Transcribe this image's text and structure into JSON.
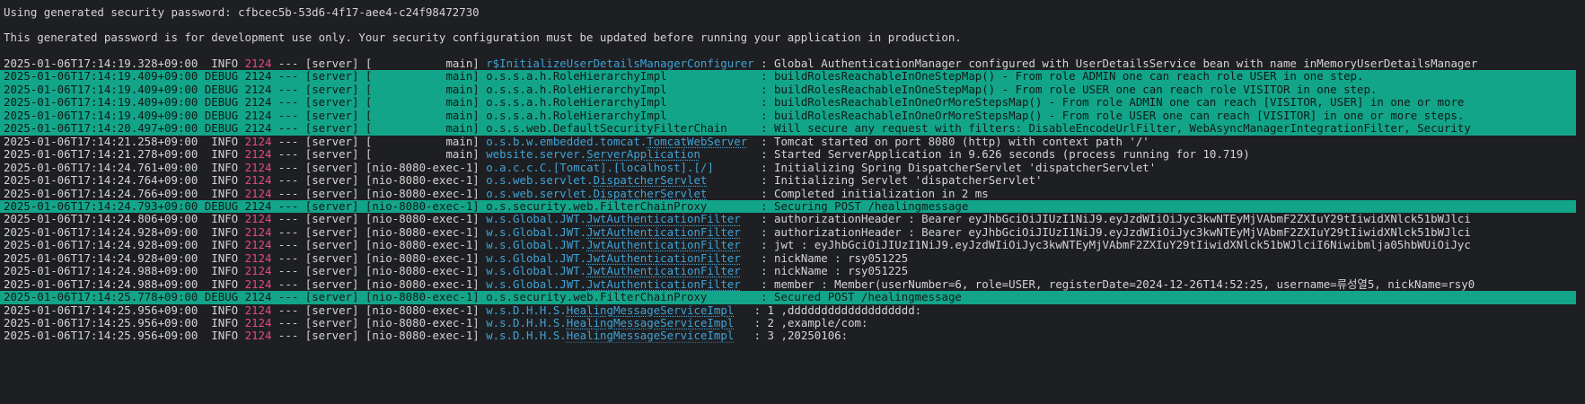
{
  "colors": {
    "background": "#1e1f22",
    "debug_row_background": "#13a58a",
    "pid": "#e24a86",
    "logger": "#3fa3d6",
    "text": "#d4d4d4"
  },
  "console": {
    "header_lines": [
      "Using generated security password: cfbcec5b-53d6-4f17-aee4-c24f98472730",
      "This generated password is for development use only. Your security configuration must be updated before running your application in production."
    ],
    "log_lines": [
      {
        "level_type": "info",
        "timestamp": "2025-01-06T17:14:19.328+09:00",
        "level": "INFO",
        "pid": "2124",
        "sep": "---",
        "app": "[server]",
        "thread": "[           main]",
        "logger_pre": "r$InitializeUserDetailsManagerConfigurer",
        "logger_link": "",
        "logger_post": " ",
        "message": ": Global AuthenticationManager configured with UserDetailsService bean with name inMemoryUserDetailsManager"
      },
      {
        "level_type": "debug",
        "timestamp": "2025-01-06T17:14:19.409+09:00",
        "level": "DEBUG",
        "pid": "2124",
        "sep": "---",
        "app": "[server]",
        "thread": "[           main]",
        "logger_pre": "o.s.s.a.h.RoleHierarchyImpl             ",
        "logger_link": "",
        "logger_post": " ",
        "message": ": buildRolesReachableInOneStepMap() - From role ADMIN one can reach role USER in one step."
      },
      {
        "level_type": "debug",
        "timestamp": "2025-01-06T17:14:19.409+09:00",
        "level": "DEBUG",
        "pid": "2124",
        "sep": "---",
        "app": "[server]",
        "thread": "[           main]",
        "logger_pre": "o.s.s.a.h.RoleHierarchyImpl             ",
        "logger_link": "",
        "logger_post": " ",
        "message": ": buildRolesReachableInOneStepMap() - From role USER one can reach role VISITOR in one step."
      },
      {
        "level_type": "debug",
        "timestamp": "2025-01-06T17:14:19.409+09:00",
        "level": "DEBUG",
        "pid": "2124",
        "sep": "---",
        "app": "[server]",
        "thread": "[           main]",
        "logger_pre": "o.s.s.a.h.RoleHierarchyImpl             ",
        "logger_link": "",
        "logger_post": " ",
        "message": ": buildRolesReachableInOneOrMoreStepsMap() - From role ADMIN one can reach [VISITOR, USER] in one or more"
      },
      {
        "level_type": "debug",
        "timestamp": "2025-01-06T17:14:19.409+09:00",
        "level": "DEBUG",
        "pid": "2124",
        "sep": "---",
        "app": "[server]",
        "thread": "[           main]",
        "logger_pre": "o.s.s.a.h.RoleHierarchyImpl             ",
        "logger_link": "",
        "logger_post": " ",
        "message": ": buildRolesReachableInOneOrMoreStepsMap() - From role USER one can reach [VISITOR] in one or more steps."
      },
      {
        "level_type": "debug",
        "timestamp": "2025-01-06T17:14:20.497+09:00",
        "level": "DEBUG",
        "pid": "2124",
        "sep": "---",
        "app": "[server]",
        "thread": "[           main]",
        "logger_pre": "o.s.s.web.DefaultSecurityFilterChain    ",
        "logger_link": "",
        "logger_post": " ",
        "message": ": Will secure any request with filters: DisableEncodeUrlFilter, WebAsyncManagerIntegrationFilter, Security"
      },
      {
        "level_type": "info",
        "timestamp": "2025-01-06T17:14:21.258+09:00",
        "level": "INFO",
        "pid": "2124",
        "sep": "---",
        "app": "[server]",
        "thread": "[           main]",
        "logger_pre": "o.s.b.w.embedded.tomcat.",
        "logger_link": "TomcatWebServer",
        "logger_post": "  ",
        "message": ": Tomcat started on port 8080 (http) with context path '/'"
      },
      {
        "level_type": "info",
        "timestamp": "2025-01-06T17:14:21.278+09:00",
        "level": "INFO",
        "pid": "2124",
        "sep": "---",
        "app": "[server]",
        "thread": "[           main]",
        "logger_pre": "website.server.",
        "logger_link": "ServerApplication",
        "logger_post": "         ",
        "message": ": Started ServerApplication in 9.626 seconds (process running for 10.719)"
      },
      {
        "level_type": "info",
        "timestamp": "2025-01-06T17:14:24.761+09:00",
        "level": "INFO",
        "pid": "2124",
        "sep": "---",
        "app": "[server]",
        "thread": "[nio-8080-exec-1]",
        "logger_pre": "o.a.c.c.C.[Tomcat].[localhost].[/]      ",
        "logger_link": "",
        "logger_post": " ",
        "message": ": Initializing Spring DispatcherServlet 'dispatcherServlet'"
      },
      {
        "level_type": "info",
        "timestamp": "2025-01-06T17:14:24.764+09:00",
        "level": "INFO",
        "pid": "2124",
        "sep": "---",
        "app": "[server]",
        "thread": "[nio-8080-exec-1]",
        "logger_pre": "o.s.web.servlet.",
        "logger_link": "DispatcherServlet",
        "logger_post": "        ",
        "message": ": Initializing Servlet 'dispatcherServlet'"
      },
      {
        "level_type": "info",
        "timestamp": "2025-01-06T17:14:24.766+09:00",
        "level": "INFO",
        "pid": "2124",
        "sep": "---",
        "app": "[server]",
        "thread": "[nio-8080-exec-1]",
        "logger_pre": "o.s.web.servlet.",
        "logger_link": "DispatcherServlet",
        "logger_post": "        ",
        "message": ": Completed initialization in 2 ms"
      },
      {
        "level_type": "debug",
        "timestamp": "2025-01-06T17:14:24.793+09:00",
        "level": "DEBUG",
        "pid": "2124",
        "sep": "---",
        "app": "[server]",
        "thread": "[nio-8080-exec-1]",
        "logger_pre": "o.s.security.web.FilterChainProxy       ",
        "logger_link": "",
        "logger_post": " ",
        "message": ": Securing POST /healingmessage"
      },
      {
        "level_type": "info",
        "timestamp": "2025-01-06T17:14:24.806+09:00",
        "level": "INFO",
        "pid": "2124",
        "sep": "---",
        "app": "[server]",
        "thread": "[nio-8080-exec-1]",
        "logger_pre": "w.s.Global.JWT.",
        "logger_link": "JwtAuthenticationFilter",
        "logger_post": "   ",
        "message": ": authorizationHeader : Bearer eyJhbGciOiJIUzI1NiJ9.eyJzdWIiOiJyc3kwNTEyMjVAbmF2ZXIuY29tIiwidXNlck51bWJlci"
      },
      {
        "level_type": "info",
        "timestamp": "2025-01-06T17:14:24.928+09:00",
        "level": "INFO",
        "pid": "2124",
        "sep": "---",
        "app": "[server]",
        "thread": "[nio-8080-exec-1]",
        "logger_pre": "w.s.Global.JWT.",
        "logger_link": "JwtAuthenticationFilter",
        "logger_post": "   ",
        "message": ": authorizationHeader : Bearer eyJhbGciOiJIUzI1NiJ9.eyJzdWIiOiJyc3kwNTEyMjVAbmF2ZXIuY29tIiwidXNlck51bWJlci"
      },
      {
        "level_type": "info",
        "timestamp": "2025-01-06T17:14:24.928+09:00",
        "level": "INFO",
        "pid": "2124",
        "sep": "---",
        "app": "[server]",
        "thread": "[nio-8080-exec-1]",
        "logger_pre": "w.s.Global.JWT.",
        "logger_link": "JwtAuthenticationFilter",
        "logger_post": "   ",
        "message": ": jwt : eyJhbGciOiJIUzI1NiJ9.eyJzdWIiOiJyc3kwNTEyMjVAbmF2ZXIuY29tIiwidXNlck51bWJlciI6Niwibmlja05hbWUiOiJyc"
      },
      {
        "level_type": "info",
        "timestamp": "2025-01-06T17:14:24.928+09:00",
        "level": "INFO",
        "pid": "2124",
        "sep": "---",
        "app": "[server]",
        "thread": "[nio-8080-exec-1]",
        "logger_pre": "w.s.Global.JWT.",
        "logger_link": "JwtAuthenticationFilter",
        "logger_post": "   ",
        "message": ": nickName : rsy051225"
      },
      {
        "level_type": "info",
        "timestamp": "2025-01-06T17:14:24.988+09:00",
        "level": "INFO",
        "pid": "2124",
        "sep": "---",
        "app": "[server]",
        "thread": "[nio-8080-exec-1]",
        "logger_pre": "w.s.Global.JWT.",
        "logger_link": "JwtAuthenticationFilter",
        "logger_post": "   ",
        "message": ": nickName : rsy051225"
      },
      {
        "level_type": "info",
        "timestamp": "2025-01-06T17:14:24.988+09:00",
        "level": "INFO",
        "pid": "2124",
        "sep": "---",
        "app": "[server]",
        "thread": "[nio-8080-exec-1]",
        "logger_pre": "w.s.Global.JWT.",
        "logger_link": "JwtAuthenticationFilter",
        "logger_post": "   ",
        "message": ": member : Member(userNumber=6, role=USER, registerDate=2024-12-26T14:52:25, username=류성열5, nickName=rsy0"
      },
      {
        "level_type": "debug",
        "timestamp": "2025-01-06T17:14:25.778+09:00",
        "level": "DEBUG",
        "pid": "2124",
        "sep": "---",
        "app": "[server]",
        "thread": "[nio-8080-exec-1]",
        "logger_pre": "o.s.security.web.FilterChainProxy       ",
        "logger_link": "",
        "logger_post": " ",
        "message": ": Secured POST /healingmessage"
      },
      {
        "level_type": "info",
        "timestamp": "2025-01-06T17:14:25.956+09:00",
        "level": "INFO",
        "pid": "2124",
        "sep": "---",
        "app": "[server]",
        "thread": "[nio-8080-exec-1]",
        "logger_pre": "w.s.D.H.H.S.",
        "logger_link": "HealingMessageServiceImpl",
        "logger_post": "   ",
        "message": ": 1 ,ddddddddddddddddddd:"
      },
      {
        "level_type": "info",
        "timestamp": "2025-01-06T17:14:25.956+09:00",
        "level": "INFO",
        "pid": "2124",
        "sep": "---",
        "app": "[server]",
        "thread": "[nio-8080-exec-1]",
        "logger_pre": "w.s.D.H.H.S.",
        "logger_link": "HealingMessageServiceImpl",
        "logger_post": "   ",
        "message": ": 2 ,example/com:"
      },
      {
        "level_type": "info",
        "timestamp": "2025-01-06T17:14:25.956+09:00",
        "level": "INFO",
        "pid": "2124",
        "sep": "---",
        "app": "[server]",
        "thread": "[nio-8080-exec-1]",
        "logger_pre": "w.s.D.H.H.S.",
        "logger_link": "HealingMessageServiceImpl",
        "logger_post": "   ",
        "message": ": 3 ,20250106:"
      }
    ]
  }
}
